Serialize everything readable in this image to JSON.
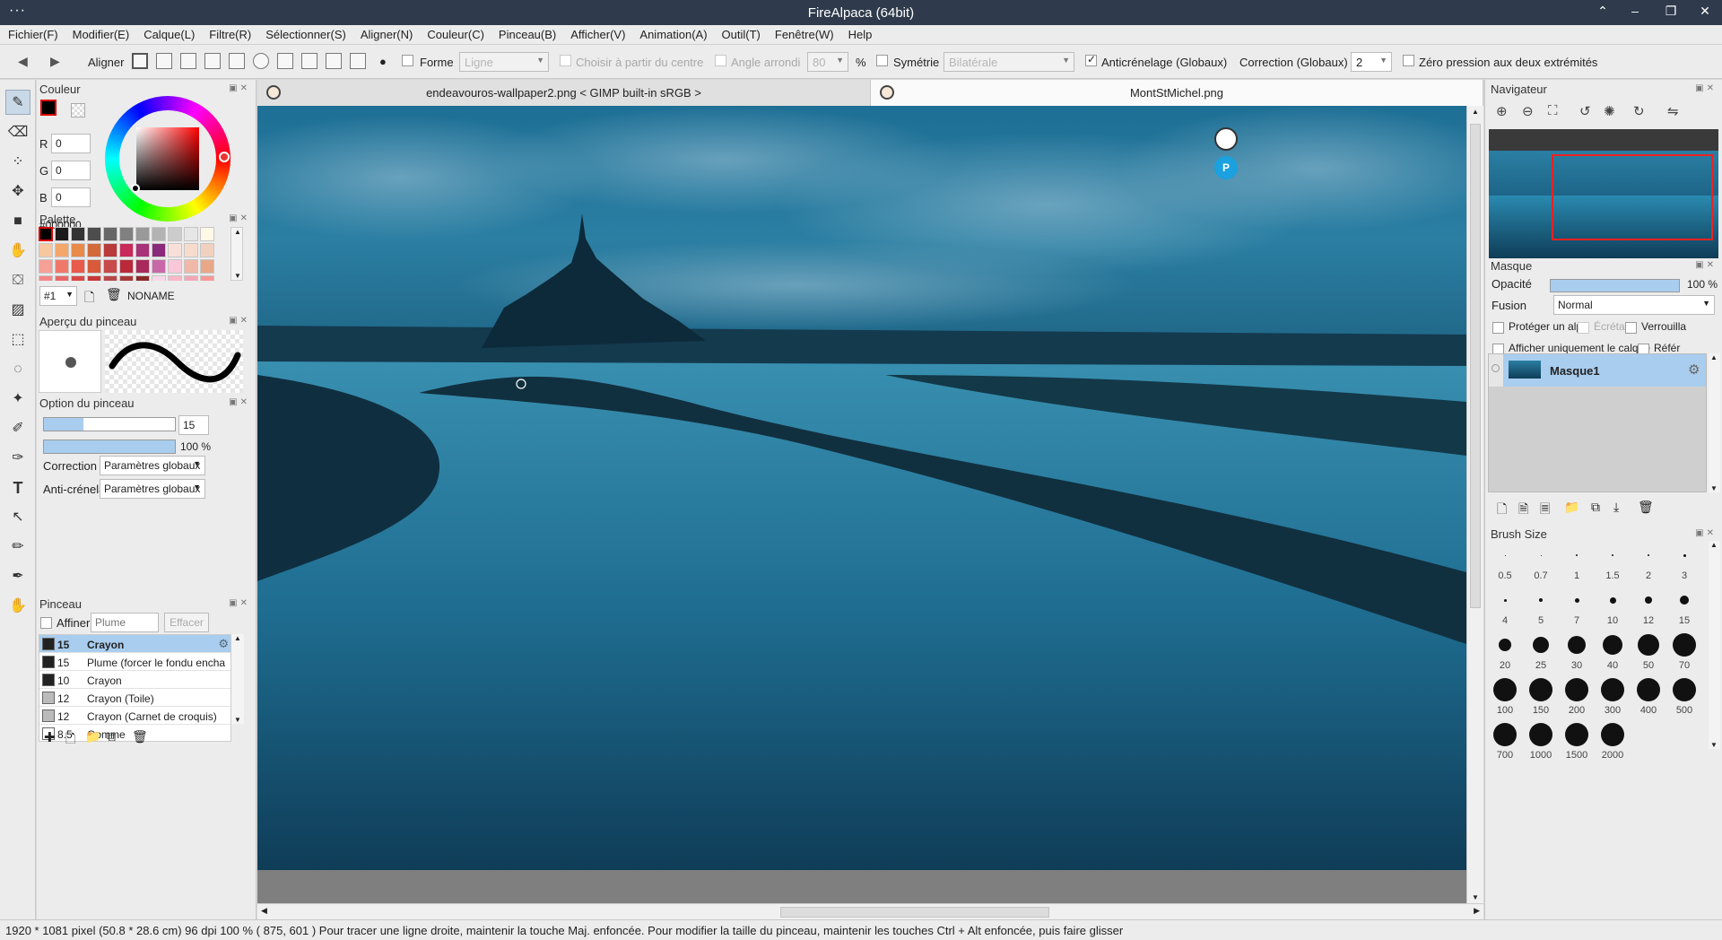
{
  "window": {
    "title": "FireAlpaca (64bit)"
  },
  "menu": [
    "Fichier(F)",
    "Modifier(E)",
    "Calque(L)",
    "Filtre(R)",
    "Sélectionner(S)",
    "Aligner(N)",
    "Couleur(C)",
    "Pinceau(B)",
    "Afficher(V)",
    "Animation(A)",
    "Outil(T)",
    "Fenêtre(W)",
    "Help"
  ],
  "toolbar": {
    "aligner": "Aligner",
    "forme": "Forme",
    "forme_value": "Ligne",
    "choisir_centre": "Choisir à partir du centre",
    "angle_arrondi": "Angle arrondi",
    "angle_value": "80",
    "percent": "%",
    "symetrie": "Symétrie",
    "symetrie_value": "Bilatérale",
    "anticrenelage": "Anticrénelage (Globaux)",
    "correction": "Correction (Globaux)",
    "correction_value": "2",
    "zero_pression": "Zéro pression aux deux extrémités"
  },
  "couleur_panel": {
    "title": "Couleur",
    "r_label": "R",
    "r_value": "0",
    "g_label": "G",
    "g_value": "0",
    "b_label": "B",
    "b_value": "0",
    "hex": "#000000"
  },
  "palette_panel": {
    "title": "Palette",
    "selector": "#1",
    "name": "NONAME",
    "colors": [
      "#000000",
      "#1a1a1a",
      "#333333",
      "#4d4d4d",
      "#666666",
      "#808080",
      "#999999",
      "#b3b3b3",
      "#cccccc",
      "#e6e6e6",
      "#fff8e6",
      "#f7c7a0",
      "#f4a76a",
      "#e88a4a",
      "#d26a3a",
      "#b83a3a",
      "#c8285a",
      "#a83278",
      "#8a2a7a",
      "#f8e0d8",
      "#f7dccc",
      "#f2d0c0",
      "#f6a098",
      "#f0786a",
      "#e85a4a",
      "#d85a3a",
      "#c84a4a",
      "#b82a3a",
      "#a82a5a",
      "#c868a8",
      "#f8c8d8",
      "#f0b8a8",
      "#e8a888",
      "#f48888",
      "#e86868",
      "#d84848",
      "#c83838",
      "#b84848",
      "#a83838",
      "#8a2828",
      "#f8d8e8",
      "#f8b8c8",
      "#f0a8b8",
      "#f89898"
    ]
  },
  "apercu_panel": {
    "title": "Aperçu du pinceau"
  },
  "option_panel": {
    "title": "Option du pinceau",
    "size_value": "15",
    "size_fill_pct": 30,
    "opacity_value": "100 %",
    "opacity_fill_pct": 100,
    "correction_label": "Correction",
    "correction_value": "Paramètres globaux",
    "anticrenelage_label": "Anti-crénelag",
    "anticrenelage_value": "Paramètres globaux"
  },
  "pinceau_panel": {
    "title": "Pinceau",
    "affiner": "Affiner",
    "plume_placeholder": "Plume",
    "effacer": "Effacer",
    "brushes": [
      {
        "size": "15",
        "name": "Crayon",
        "selected": true
      },
      {
        "size": "15",
        "name": "Plume (forcer le fondu encha",
        "selected": false
      },
      {
        "size": "10",
        "name": "Crayon",
        "selected": false
      },
      {
        "size": "12",
        "name": "Crayon (Toile)",
        "selected": false
      },
      {
        "size": "12",
        "name": "Crayon (Carnet de croquis)",
        "selected": false
      },
      {
        "size": "8.5",
        "name": "Gomme",
        "selected": false
      }
    ]
  },
  "tabs": [
    {
      "label": "endeavouros-wallpaper2.png < GIMP built-in sRGB >",
      "active": false
    },
    {
      "label": "MontStMichel.png",
      "active": true
    }
  ],
  "navigator": {
    "title": "Navigateur"
  },
  "masque_panel": {
    "title": "Masque",
    "opacite_label": "Opacité",
    "opacite_value": "100 %",
    "opacite_fill_pct": 100,
    "fusion_label": "Fusion",
    "fusion_value": "Normal",
    "proteger": "Protéger un alp",
    "ecreta": "Écréta",
    "verrouilla": "Verrouilla",
    "afficher_calque": "Afficher uniquement le calque",
    "referer": "Référ",
    "layer_name": "Masque1"
  },
  "brush_size_panel": {
    "title": "Brush Size",
    "sizes": [
      "0.5",
      "0.7",
      "1",
      "1.5",
      "2",
      "3",
      "4",
      "5",
      "7",
      "10",
      "12",
      "15",
      "20",
      "25",
      "30",
      "40",
      "50",
      "70",
      "100",
      "150",
      "200",
      "300",
      "400",
      "500",
      "700",
      "1000",
      "1500",
      "2000"
    ]
  },
  "status": "1920 * 1081 pixel   (50.8 * 28.6 cm)   96 dpi    100 %    ( 875, 601 )   Pour tracer une ligne droite, maintenir la touche Maj. enfoncée. Pour modifier la taille du pinceau, maintenir les touches Ctrl + Alt enfoncée, puis faire glisser"
}
